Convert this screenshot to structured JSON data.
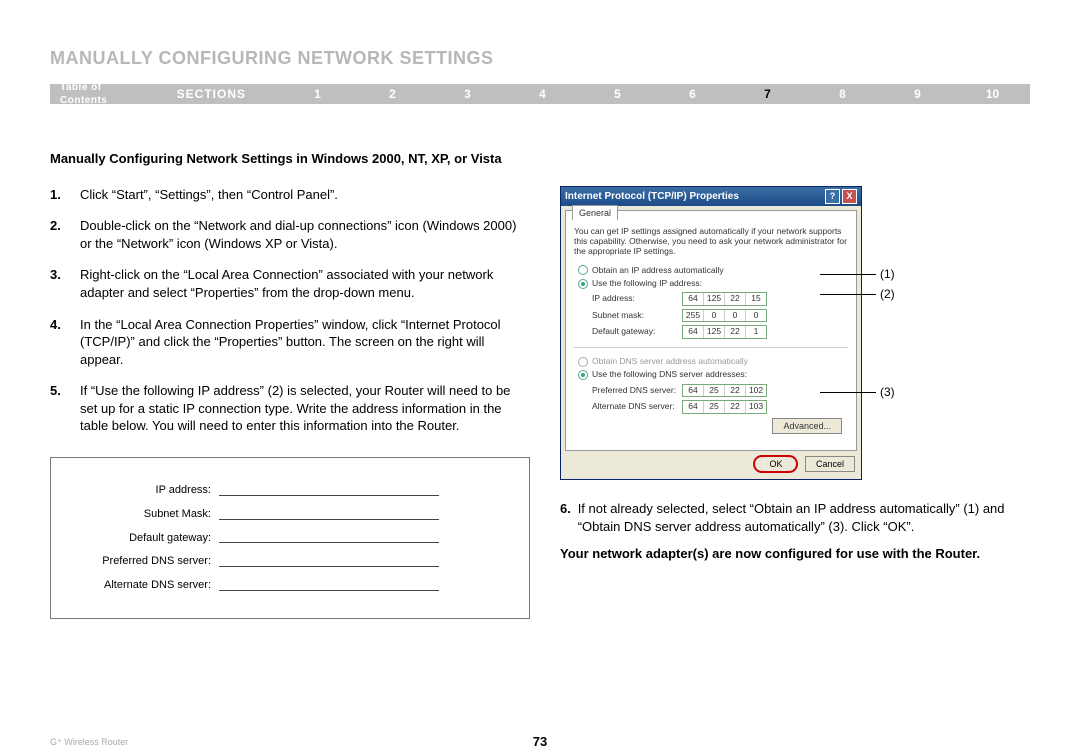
{
  "heading": "MANUALLY CONFIGURING NETWORK SETTINGS",
  "navbar": {
    "toc": "Table of Contents",
    "sections_label": "SECTIONS",
    "sections": [
      "1",
      "2",
      "3",
      "4",
      "5",
      "6",
      "7",
      "8",
      "9",
      "10"
    ],
    "active": "7"
  },
  "subheading": "Manually Configuring Network Settings in Windows 2000, NT, XP, or Vista",
  "steps_left": [
    "Click “Start”, “Settings”, then “Control Panel”.",
    "Double-click on the “Network and dial-up connections” icon (Windows 2000) or the “Network” icon (Windows XP or Vista).",
    "Right-click on the “Local Area Connection” associated with your network adapter and select “Properties” from the drop-down menu.",
    "In the “Local Area Connection Properties” window, click “Internet Protocol (TCP/IP)” and click the “Properties” button. The screen on the right will appear.",
    "If “Use the following IP address” (2) is selected, your Router will need to be set up for a static IP connection type. Write the address information in the table below. You will need to enter this information into the Router."
  ],
  "info_table": {
    "labels": [
      "IP address:",
      "Subnet Mask:",
      "Default gateway:",
      "Preferred DNS server:",
      "Alternate DNS server:"
    ]
  },
  "dialog": {
    "title": "Internet Protocol (TCP/IP) Properties",
    "tab_label": "General",
    "desc": "You can get IP settings assigned automatically if your network supports this capability. Otherwise, you need to ask your network administrator for the appropriate IP settings.",
    "radio_obtain_ip": "Obtain an IP address automatically",
    "radio_use_ip": "Use the following IP address:",
    "f_ip": {
      "label": "IP address:",
      "octets": [
        "64",
        "125",
        "22",
        "15"
      ]
    },
    "f_mask": {
      "label": "Subnet mask:",
      "octets": [
        "255",
        "0",
        "0",
        "0"
      ]
    },
    "f_gw": {
      "label": "Default gateway:",
      "octets": [
        "64",
        "125",
        "22",
        "1"
      ]
    },
    "radio_obtain_dns": "Obtain DNS server address automatically",
    "radio_use_dns": "Use the following DNS server addresses:",
    "f_pdns": {
      "label": "Preferred DNS server:",
      "octets": [
        "64",
        "25",
        "22",
        "102"
      ]
    },
    "f_adns": {
      "label": "Alternate DNS server:",
      "octets": [
        "64",
        "25",
        "22",
        "103"
      ]
    },
    "advanced": "Advanced...",
    "ok": "OK",
    "cancel": "Cancel"
  },
  "callouts": {
    "c1": "(1)",
    "c2": "(2)",
    "c3": "(3)"
  },
  "step6": {
    "num": "6.",
    "text": "If not already selected, select “Obtain an IP address automatically” (1) and “Obtain DNS server address automatically” (3). Click “OK”."
  },
  "final_note": "Your network adapter(s) are now configured for use with the Router.",
  "footer": {
    "product": "G⁺ Wireless Router",
    "page": "73"
  }
}
